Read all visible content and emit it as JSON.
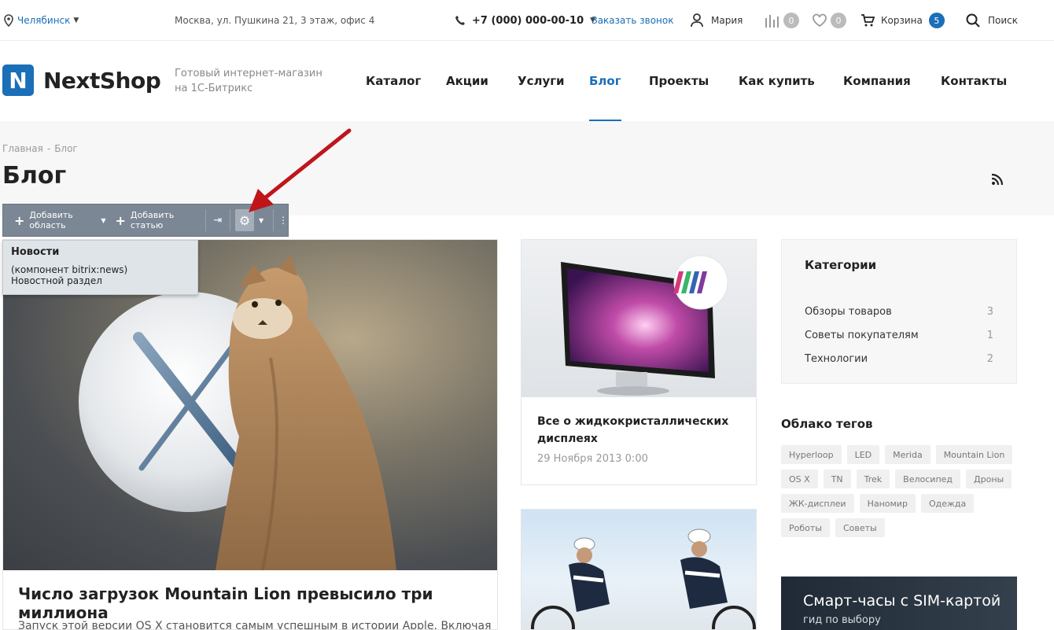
{
  "topbar": {
    "city": "Челябинск",
    "address": "Москва, ул. Пушкина 21, 3 этаж, офис 4",
    "phone": "+7 (000) 000-00-10",
    "callback": "Заказать звонок",
    "user": "Мария",
    "compare_count": "0",
    "favorites_count": "0",
    "cart_label": "Корзина",
    "cart_count": "5",
    "search_label": "Поиск"
  },
  "header": {
    "logo_letter": "N",
    "logo_text": "NextShop",
    "slogan_line1": "Готовый интернет-магазин",
    "slogan_line2": "на 1С-Битрикс",
    "nav": [
      {
        "label": "Каталог"
      },
      {
        "label": "Акции"
      },
      {
        "label": "Услуги"
      },
      {
        "label": "Блог"
      },
      {
        "label": "Проекты"
      },
      {
        "label": "Как купить"
      },
      {
        "label": "Компания"
      },
      {
        "label": "Контакты"
      }
    ]
  },
  "page": {
    "breadcrumbs": [
      "Главная",
      "Блог"
    ],
    "title": "Блог"
  },
  "bitrix": {
    "add_area": "Добавить область",
    "add_article": "Добавить статью",
    "tooltip_title": "Новости",
    "tooltip_component": "(компонент bitrix:news)",
    "tooltip_desc": "Новостной раздел"
  },
  "articles": {
    "main": {
      "title": "Число загрузок Mountain Lion превысило три миллиона",
      "text": "Запуск этой версии OS X становится самым успешным в истории Apple. Включая"
    },
    "side": [
      {
        "title": "Все о жидкокристаллических дисплеях",
        "date": "29 Ноября 2013 0:00"
      }
    ]
  },
  "sidebar": {
    "categories_title": "Категории",
    "categories": [
      {
        "label": "Обзоры товаров",
        "count": "3"
      },
      {
        "label": "Советы покупателям",
        "count": "1"
      },
      {
        "label": "Технологии",
        "count": "2"
      }
    ],
    "tags_title": "Облако тегов",
    "tags": [
      "Hyperloop",
      "LED",
      "Merida",
      "Mountain Lion",
      "OS X",
      "TN",
      "Trek",
      "Велосипед",
      "Дроны",
      "ЖК-дисплеи",
      "Наномир",
      "Одежда",
      "Роботы",
      "Советы"
    ],
    "promo_title": "Смарт-часы с SIM-картой",
    "promo_sub": "гид по выбору"
  },
  "colors": {
    "accent": "#1a6fb8",
    "arrow": "#c0151b",
    "bitrix_bar": "#7b8794"
  }
}
